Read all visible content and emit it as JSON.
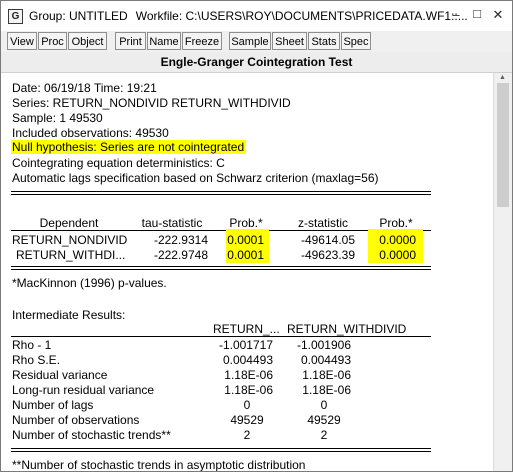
{
  "window": {
    "icon_letter": "G",
    "title": "Group: UNTITLED",
    "workfile": "Workfile: C:\\USERS\\ROY\\DOCUMENTS\\PRICEDATA.WF1::...",
    "min_glyph": "–",
    "max_glyph": "□",
    "close_glyph": "✕"
  },
  "toolbar": {
    "buttons": [
      "View",
      "Proc",
      "Object",
      "Print",
      "Name",
      "Freeze",
      "Sample",
      "Sheet",
      "Stats",
      "Spec"
    ]
  },
  "output": {
    "heading": "Engle-Granger Cointegration Test",
    "header_lines": [
      "Date: 06/19/18   Time: 19:21",
      "Series: RETURN_NONDIVID RETURN_WITHDIVID",
      "Sample: 1 49530",
      "Included observations: 49530",
      "Null hypothesis: Series are not cointegrated",
      "Cointegrating equation deterministics: C",
      "Automatic lags specification based on Schwarz criterion (maxlag=56)"
    ],
    "test_table": {
      "columns": [
        "Dependent",
        "tau-statistic",
        "Prob.*",
        "z-statistic",
        "Prob.*"
      ],
      "rows": [
        [
          "RETURN_NONDIVID",
          "-222.9314",
          "0.0001",
          "-49614.05",
          "0.0000"
        ],
        [
          "RETURN_WITHDI...",
          "-222.9748",
          "0.0001",
          "-49623.39",
          "0.0000"
        ]
      ]
    },
    "footnote": "*MacKinnon (1996) p-values.",
    "intermediate_title": "Intermediate Results:",
    "intermediate_table": {
      "columns": [
        "RETURN_...",
        "RETURN_WITHDIVID"
      ],
      "rows": [
        [
          "Rho - 1",
          "-1.001717",
          "-1.001906"
        ],
        [
          "Rho S.E.",
          "0.004493",
          "0.004493"
        ],
        [
          "Residual variance",
          "1.18E-06",
          "1.18E-06"
        ],
        [
          "Long-run residual variance",
          "1.18E-06",
          "1.18E-06"
        ],
        [
          "Number of lags",
          "0",
          "0"
        ],
        [
          "Number of observations",
          "49529",
          "49529"
        ],
        [
          "Number of stochastic trends**",
          "2",
          "2"
        ]
      ]
    },
    "footnote2": "**Number of stochastic trends in asymptotic distribution"
  },
  "colors": {
    "highlight": "#ffff00"
  }
}
